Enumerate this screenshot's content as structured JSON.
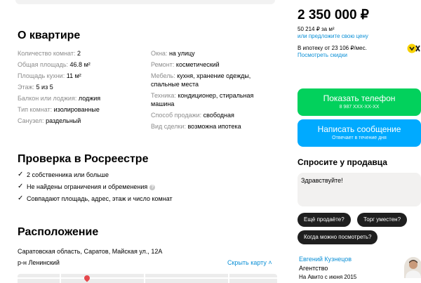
{
  "about": {
    "title": "О квартире",
    "left": [
      {
        "k": "Количество комнат:",
        "v": "2"
      },
      {
        "k": "Общая площадь:",
        "v": "46.8 м²"
      },
      {
        "k": "Площадь кухни:",
        "v": "11 м²"
      },
      {
        "k": "Этаж:",
        "v": "5 из 5"
      },
      {
        "k": "Балкон или лоджия:",
        "v": "лоджия"
      },
      {
        "k": "Тип комнат:",
        "v": "изолированные"
      },
      {
        "k": "Санузел:",
        "v": "раздельный"
      }
    ],
    "right": [
      {
        "k": "Окна:",
        "v": "на улицу"
      },
      {
        "k": "Ремонт:",
        "v": "косметический"
      },
      {
        "k": "Мебель:",
        "v": "кухня, хранение одежды, спальные места"
      },
      {
        "k": "Техника:",
        "v": "кондиционер, стиральная машина"
      },
      {
        "k": "Способ продажи:",
        "v": "свободная"
      },
      {
        "k": "Вид сделки:",
        "v": "возможна ипотека"
      }
    ]
  },
  "rosreestr": {
    "title": "Проверка в Росреестре",
    "items": [
      "2 собственника или больше",
      "Не найдены ограничения и обременения",
      "Совпадают площадь, адрес, этаж и число комнат"
    ]
  },
  "location": {
    "title": "Расположение",
    "address": "Саратовская область, Саратов, Майская ул., 12А",
    "district": "р-н Ленинский",
    "hide_map": "Скрыть карту"
  },
  "pricing": {
    "price": "2 350 000 ₽",
    "per_m": "50 214 ₽ за м²",
    "offer": "или предложите свою цену",
    "mortgage": "В ипотеку от 23 106 ₽/мес.",
    "discounts": "Посмотреть скидки"
  },
  "buttons": {
    "phone": "Показать телефон",
    "phone_number": "8 987 XXX-XX-XX",
    "message": "Написать сообщение",
    "message_sub": "Отвечает в течение дня"
  },
  "ask": {
    "title": "Спросите у продавца",
    "text": "Здравствуйте!",
    "chips": [
      "Ещё продаёте?",
      "Торг уместен?",
      "Когда можно посмотреть?"
    ]
  },
  "seller": {
    "name": "Евгений Кузнецов",
    "type": "Агентство",
    "since": "На Авито с июня 2015"
  },
  "colors": {
    "phone_button": "#02d15c",
    "message_button": "#00aaff",
    "link": "#0a8fd6"
  }
}
